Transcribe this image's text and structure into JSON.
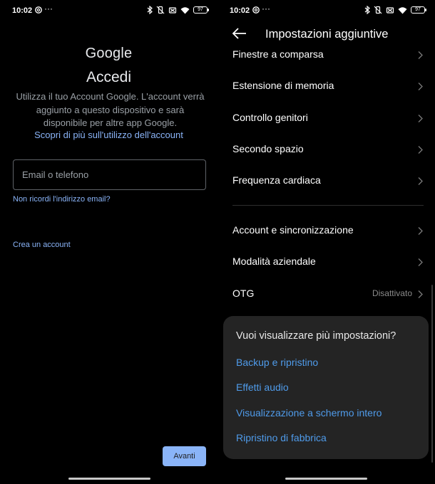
{
  "left": {
    "status": {
      "time": "10:02",
      "dots": "···",
      "battery": "97"
    },
    "logo": "Google",
    "title": "Accedi",
    "description": "Utilizza il tuo Account Google. L'account verrà aggiunto a questo dispositivo e sarà disponibile per altre app Google.",
    "learn_more": "Scopri di più sull'utilizzo dell'account",
    "email_placeholder": "Email o telefono",
    "forgot_email": "Non ricordi l'indirizzo email?",
    "create_account": "Crea un account",
    "next_button": "Avanti"
  },
  "right": {
    "status": {
      "time": "10:02",
      "dots": "···",
      "battery": "97"
    },
    "title": "Impostazioni aggiuntive",
    "items": [
      {
        "label": "Finestre a comparsa",
        "value": ""
      },
      {
        "label": "Estensione di memoria",
        "value": ""
      },
      {
        "label": "Controllo genitori",
        "value": ""
      },
      {
        "label": "Secondo spazio",
        "value": ""
      },
      {
        "label": "Frequenza cardiaca",
        "value": ""
      },
      {
        "label": "Account e sincronizzazione",
        "value": ""
      },
      {
        "label": "Modalità aziendale",
        "value": ""
      },
      {
        "label": "OTG",
        "value": "Disattivato"
      }
    ],
    "popup": {
      "question": "Vuoi visualizzare più impostazioni?",
      "options": [
        "Backup e ripristino",
        "Effetti audio",
        "Visualizzazione a schermo intero",
        "Ripristino di fabbrica"
      ]
    }
  },
  "colors": {
    "link_blue": "#8ab4f8",
    "popup_option_blue": "#4f9bea",
    "popup_bg": "#242424"
  }
}
